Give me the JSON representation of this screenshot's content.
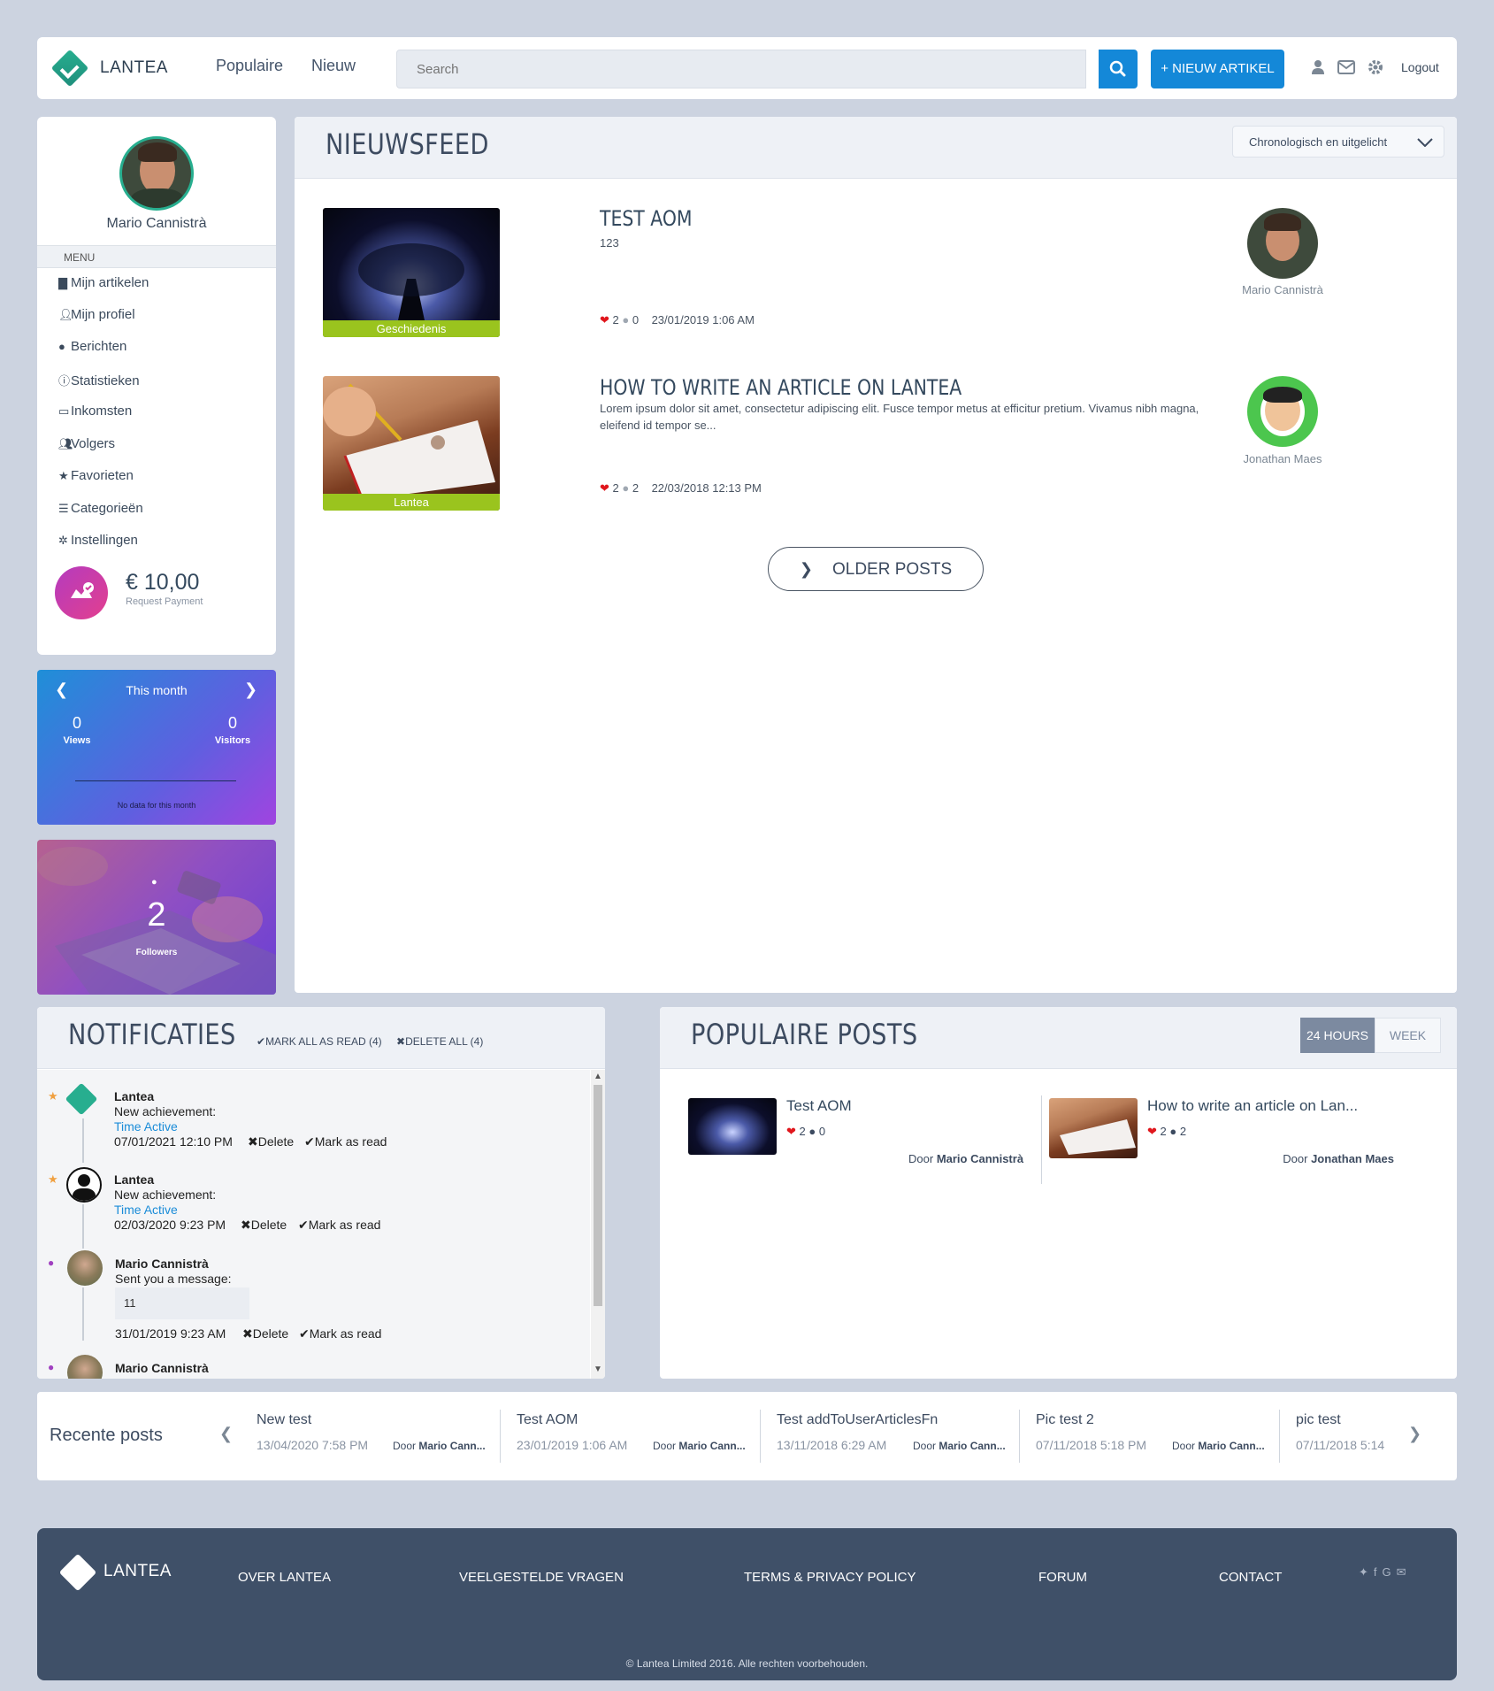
{
  "topbar": {
    "brand": "LANTEA",
    "nav": [
      "Populaire",
      "Nieuw"
    ],
    "search_placeholder": "Search",
    "new_article": "+ NIEUW ARTIKEL",
    "logout": "Logout"
  },
  "profile": {
    "name": "Mario Cannistrà",
    "menu_label": "MENU",
    "menu": [
      {
        "label": "Mijn artikelen",
        "icon": "file-icon"
      },
      {
        "label": "Mijn profiel",
        "icon": "user-icon"
      },
      {
        "label": "Berichten",
        "icon": "comment-icon"
      },
      {
        "label": "Statistieken",
        "icon": "info-icon"
      },
      {
        "label": "Inkomsten",
        "icon": "credit-card-icon"
      },
      {
        "label": "Volgers",
        "icon": "users-icon"
      },
      {
        "label": "Favorieten",
        "icon": "star-icon"
      },
      {
        "label": "Categorieën",
        "icon": "list-icon"
      },
      {
        "label": "Instellingen",
        "icon": "gear-icon"
      }
    ],
    "balance": "€ 10,00",
    "balance_label": "Request Payment"
  },
  "stats": {
    "period": "This month",
    "views": "0",
    "views_label": "Views",
    "visitors": "0",
    "visitors_label": "Visitors",
    "no_data": "No data for this month"
  },
  "followers": {
    "count": "2",
    "label": "Followers"
  },
  "feed": {
    "title": "NIEUWSFEED",
    "sort": "Chronologisch en uitgelicht",
    "posts": [
      {
        "title": "TEST AOM",
        "excerpt": "123",
        "category": "Geschiedenis",
        "likes": "2",
        "comments": "0",
        "date": "23/01/2019 1:06 AM",
        "author": "Mario Cannistrà"
      },
      {
        "title": "HOW TO WRITE AN ARTICLE ON LANTEA",
        "excerpt": "Lorem ipsum dolor sit amet, consectetur adipiscing elit. Fusce tempor metus at efficitur pretium. Vivamus nibh magna, eleifend id tempor se...",
        "category": "Lantea",
        "likes": "2",
        "comments": "2",
        "date": "22/03/2018 12:13 PM",
        "author": "Jonathan Maes"
      }
    ],
    "older": "OLDER POSTS"
  },
  "notifications": {
    "title": "NOTIFICATIES",
    "mark_all": "MARK ALL AS READ (4)",
    "delete_all": "DELETE ALL (4)",
    "items": [
      {
        "from": "Lantea",
        "text": "New achievement:",
        "link": "Time Active",
        "date": "07/01/2021 12:10 PM",
        "message": ""
      },
      {
        "from": "Lantea",
        "text": "New achievement:",
        "link": "Time Active",
        "date": "02/03/2020 9:23 PM",
        "message": ""
      },
      {
        "from": "Mario Cannistrà",
        "text": "Sent you a message:",
        "link": "",
        "date": "31/01/2019 9:23 AM",
        "message": "11"
      },
      {
        "from": "Mario Cannistrà",
        "text": "",
        "link": "",
        "date": "",
        "message": ""
      }
    ],
    "delete": "Delete",
    "mark_read": "Mark as read"
  },
  "popular": {
    "title": "POPULAIRE POSTS",
    "tabs": [
      "24 HOURS",
      "WEEK"
    ],
    "posts": [
      {
        "title": "Test AOM",
        "likes": "2",
        "comments": "0",
        "door": "Door",
        "author": "Mario Cannistrà"
      },
      {
        "title": "How to write an article on Lan...",
        "likes": "2",
        "comments": "2",
        "door": "Door",
        "author": "Jonathan Maes"
      }
    ]
  },
  "recent": {
    "title": "Recente posts",
    "posts": [
      {
        "title": "New test",
        "date": "13/04/2020 7:58 PM",
        "door": "Door",
        "author": "Mario Cann..."
      },
      {
        "title": "Test AOM",
        "date": "23/01/2019 1:06 AM",
        "door": "Door",
        "author": "Mario Cann..."
      },
      {
        "title": "Test addToUserArticlesFn",
        "date": "13/11/2018 6:29 AM",
        "door": "Door",
        "author": "Mario Cann..."
      },
      {
        "title": "Pic test 2",
        "date": "07/11/2018 5:18 PM",
        "door": "Door",
        "author": "Mario Cann..."
      },
      {
        "title": "pic test",
        "date": "07/11/2018 5:14",
        "door": "",
        "author": ""
      }
    ]
  },
  "footer": {
    "brand": "LANTEA",
    "links": [
      "OVER LANTEA",
      "VEELGESTELDE VRAGEN",
      "TERMS & PRIVACY POLICY",
      "FORUM",
      "CONTACT"
    ],
    "copyright": "© Lantea Limited 2016. Alle rechten voorbehouden."
  },
  "colors": {
    "accent": "#1488d8",
    "teal": "#27ae8f",
    "tag_green": "#9ac41e",
    "footer": "#3f5068",
    "heart": "#e0161c"
  }
}
